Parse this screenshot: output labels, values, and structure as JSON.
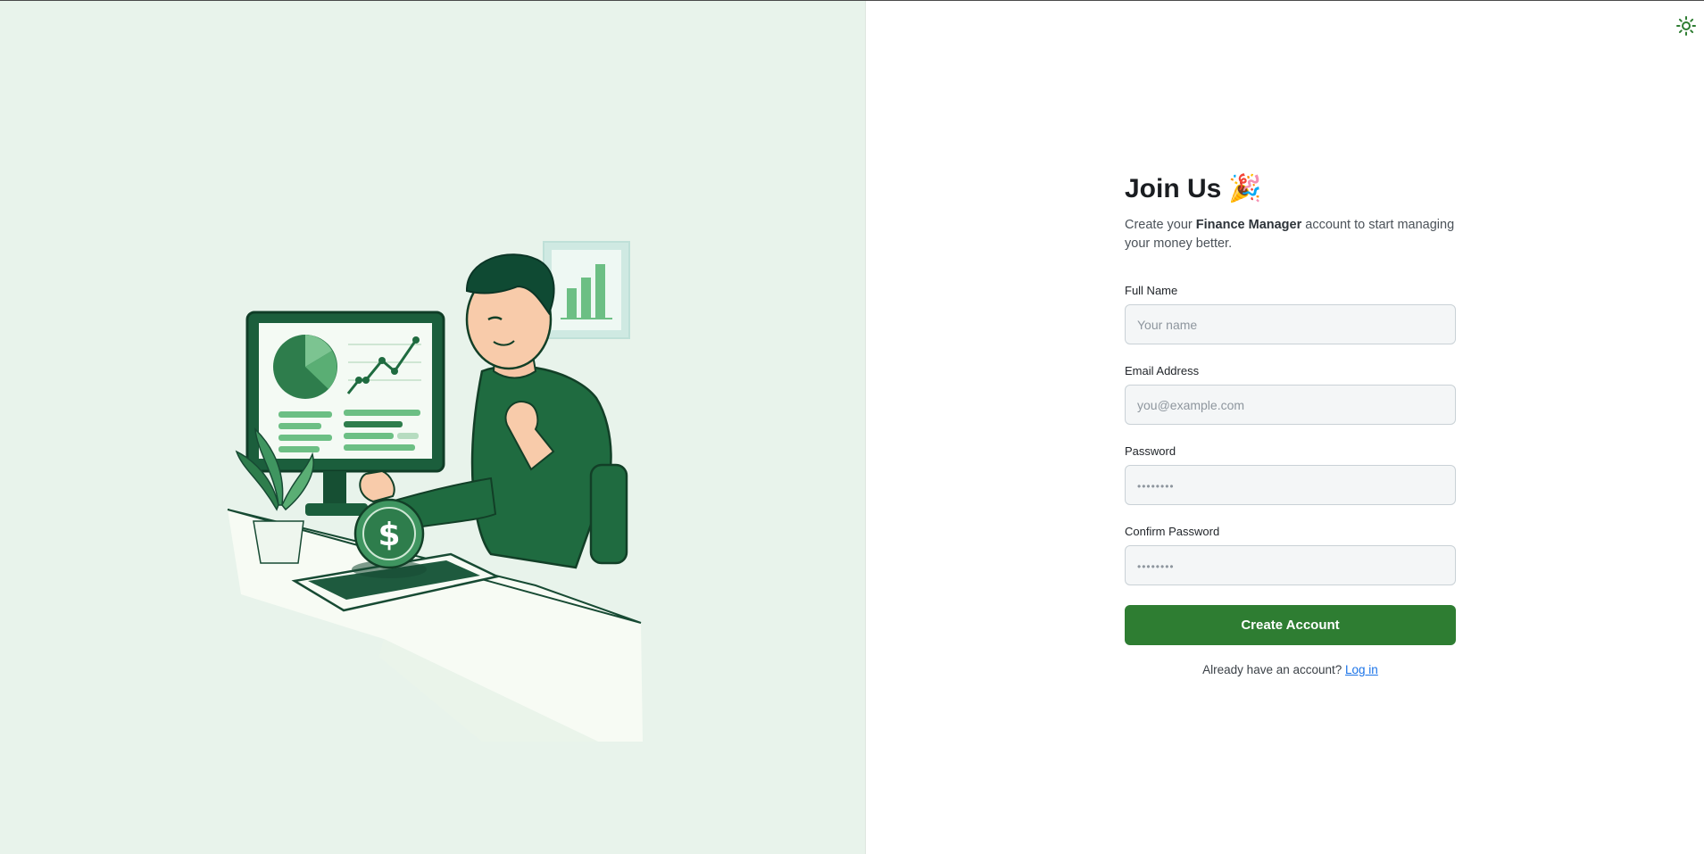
{
  "header": {
    "theme_toggle_icon": "sun-icon"
  },
  "hero": {
    "illustration": "person-with-finance-dashboard-illustration",
    "brand_green": "#2e7d32",
    "panel_bg": "#e8f3eb"
  },
  "form": {
    "title": "Join Us",
    "title_emoji": "🎉",
    "subtitle_prefix": "Create your ",
    "subtitle_brand": "Finance Manager",
    "subtitle_suffix": " account to start managing your money better.",
    "fields": [
      {
        "label": "Full Name",
        "placeholder": "Your name",
        "value": ""
      },
      {
        "label": "Email Address",
        "placeholder": "you@example.com",
        "value": ""
      },
      {
        "label": "Password",
        "placeholder": "••••••••",
        "value": ""
      },
      {
        "label": "Confirm Password",
        "placeholder": "••••••••",
        "value": ""
      }
    ],
    "submit_label": "Create Account",
    "login_prompt": "Already have an account?",
    "login_link": "Log in"
  }
}
